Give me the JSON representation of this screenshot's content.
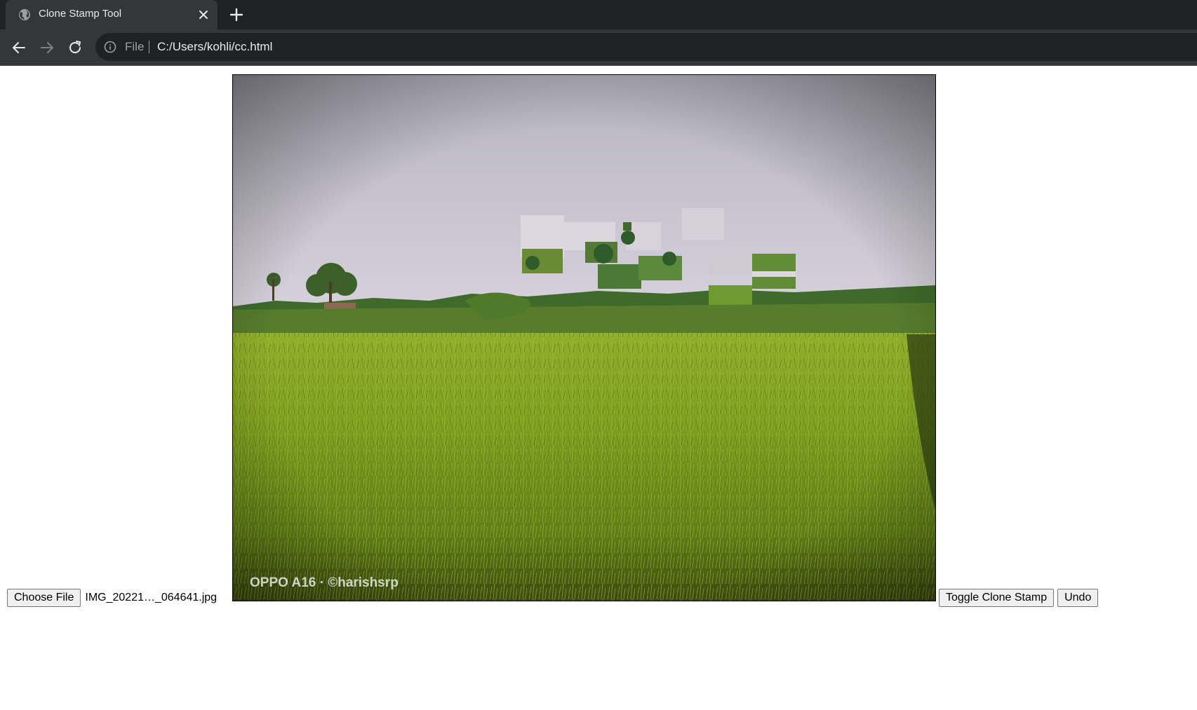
{
  "browser": {
    "tab": {
      "title": "Clone Stamp Tool"
    },
    "address": {
      "scheme": "File",
      "url": "C:/Users/kohli/cc.html"
    }
  },
  "controls": {
    "choose_file_label": "Choose File",
    "file_name": "IMG_20221…_064641.jpg",
    "toggle_label": "Toggle Clone Stamp",
    "undo_label": "Undo"
  },
  "canvas": {
    "watermark": "OPPO A16 · ©harishsrp"
  },
  "colors": {
    "chrome_dark": "#202124",
    "chrome_mid": "#35363a",
    "sky_top": "#b9b6c2",
    "sky_bottom": "#e3dde4",
    "field_green": "#7a9a1e"
  }
}
